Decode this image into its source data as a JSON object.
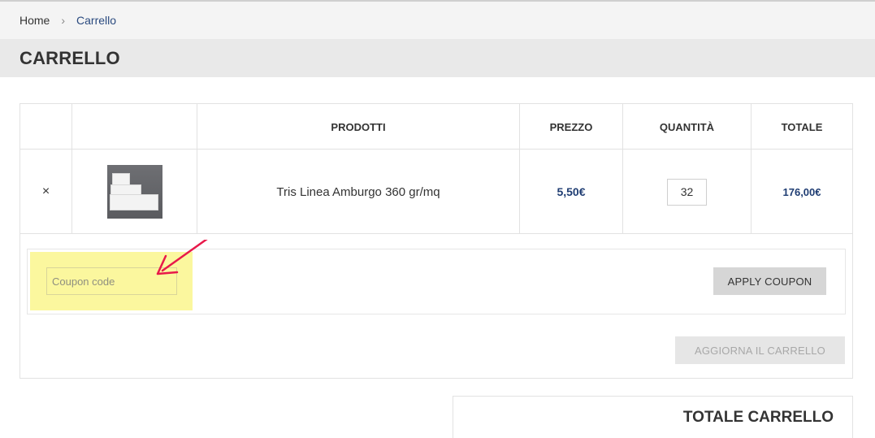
{
  "breadcrumb": {
    "home": "Home",
    "separator": "›",
    "current": "Carrello"
  },
  "page": {
    "title": "CARRELLO"
  },
  "cart": {
    "headers": {
      "products": "PRODOTTI",
      "price": "PREZZO",
      "quantity": "QUANTITÀ",
      "total": "TOTALE"
    },
    "items": [
      {
        "remove": "×",
        "name": "Tris Linea Amburgo 360 gr/mq",
        "price": "5,50€",
        "quantity": "32",
        "total": "176,00€"
      }
    ],
    "coupon": {
      "placeholder": "Coupon code",
      "apply_label": "APPLY COUPON"
    },
    "update_label": "AGGIORNA IL CARRELLO"
  },
  "totals": {
    "title": "TOTALE CARRELLO"
  },
  "colors": {
    "accent": "#1f3d73",
    "highlight": "#fbf79e",
    "arrow": "#e8194a"
  },
  "icons": {
    "remove": "close-icon",
    "annotation": "arrow-icon"
  }
}
